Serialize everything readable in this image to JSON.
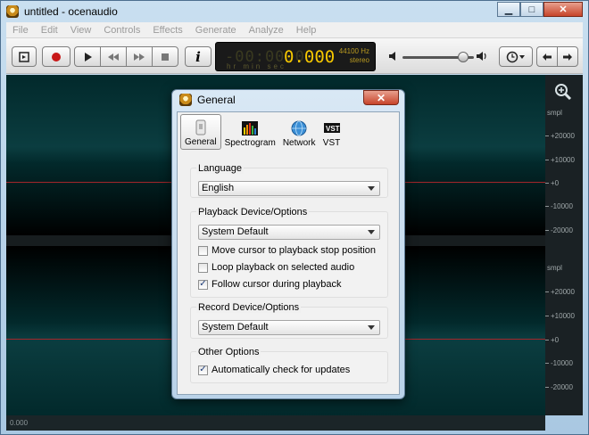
{
  "window": {
    "title": "untitled - ocenaudio",
    "controls": {
      "minimize": "▁",
      "maximize": "□",
      "close": "✕"
    }
  },
  "menu": [
    "File",
    "Edit",
    "View",
    "Controls",
    "Effects",
    "Generate",
    "Analyze",
    "Help"
  ],
  "toolbar": {
    "buttons": [
      "view-toggle",
      "record",
      "play",
      "rewind",
      "fast-forward",
      "stop",
      "info",
      "clock",
      "back",
      "forward"
    ],
    "info_label": "i",
    "display": {
      "dim_digits": "-00:00.0",
      "time": "0.000",
      "sample_rate": "44100 Hz",
      "channels": "stereo",
      "units": "hr   min sec"
    },
    "volume_fraction": 0.82
  },
  "waveform": {
    "ruler_labels": [
      "smpl",
      "+20000",
      "+10000",
      "+0",
      "-10000",
      "-20000",
      "smpl",
      "+20000",
      "+10000",
      "+0",
      "-10000",
      "-20000"
    ],
    "time_start": "0.000"
  },
  "dialog": {
    "title": "General",
    "close": "✕",
    "tabs": [
      {
        "label": "General",
        "active": true,
        "icon": "general-icon"
      },
      {
        "label": "Spectrogram",
        "active": false,
        "icon": "spectrogram-icon"
      },
      {
        "label": "Network",
        "active": false,
        "icon": "globe-icon"
      },
      {
        "label": "VST",
        "active": false,
        "icon": "vst-icon"
      }
    ],
    "language": {
      "title": "Language",
      "value": "English"
    },
    "playback": {
      "title": "Playback Device/Options",
      "device": "System Default",
      "options": [
        {
          "label": "Move cursor to playback stop position",
          "checked": false
        },
        {
          "label": "Loop playback on selected audio",
          "checked": false
        },
        {
          "label": "Follow cursor during playback",
          "checked": true
        }
      ]
    },
    "record": {
      "title": "Record Device/Options",
      "device": "System Default"
    },
    "other": {
      "title": "Other Options",
      "options": [
        {
          "label": "Automatically check for updates",
          "checked": true
        }
      ]
    }
  },
  "colors": {
    "waveform_bg": "#02292b",
    "center_line": "#a3262a",
    "display_time": "#f6c800"
  }
}
